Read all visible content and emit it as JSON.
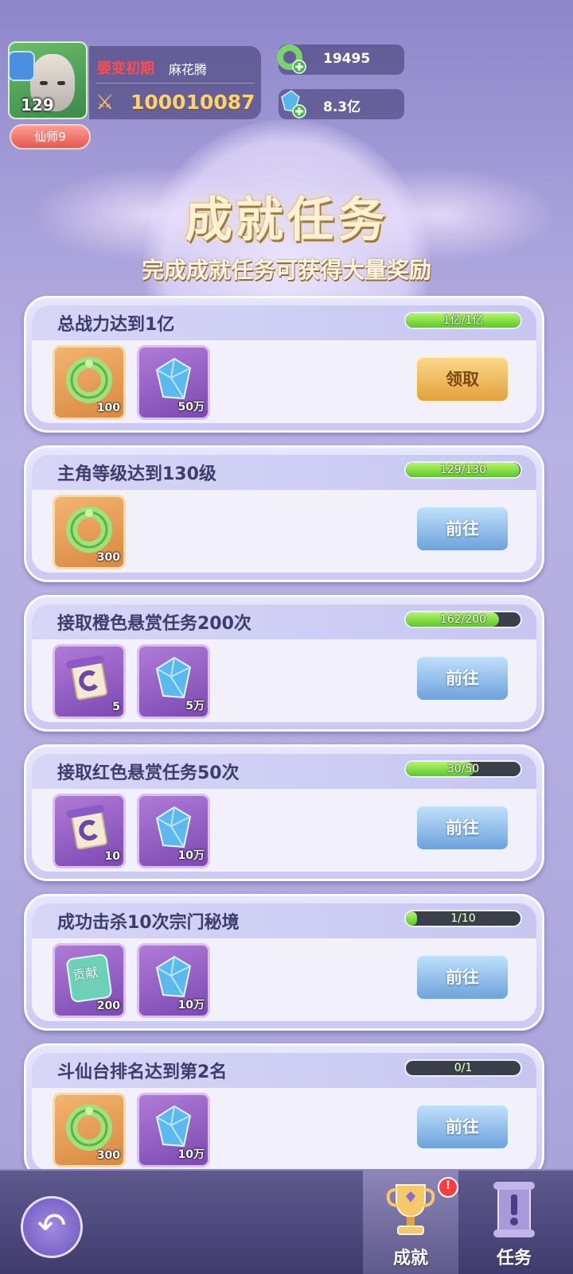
{
  "player": {
    "level": "129",
    "title": "仙师9",
    "realm": "婴变初期",
    "name": "麻花腾",
    "power": "100010087"
  },
  "resources": [
    {
      "icon": "jade-ring-icon",
      "value": "19495"
    },
    {
      "icon": "crystal-icon",
      "value": "8.3亿"
    }
  ],
  "header": {
    "title": "成就任务",
    "subtitle": "完成成就任务可获得大量奖励"
  },
  "tasks": [
    {
      "title": "总战力达到1亿",
      "progress_text": "1亿/1亿",
      "progress": 1.0,
      "rewards": [
        {
          "icon": "jade-ring-icon",
          "count": "100"
        },
        {
          "icon": "crystal-icon",
          "count": "50万"
        }
      ],
      "button": "领取",
      "button_type": "claim"
    },
    {
      "title": "主角等级达到130级",
      "progress_text": "129/130",
      "progress": 0.992,
      "rewards": [
        {
          "icon": "jade-ring-icon",
          "count": "300"
        }
      ],
      "button": "前往",
      "button_type": "go"
    },
    {
      "title": "接取橙色悬赏任务200次",
      "progress_text": "162/200",
      "progress": 0.81,
      "rewards": [
        {
          "icon": "scroll-icon",
          "count": "5"
        },
        {
          "icon": "crystal-icon",
          "count": "5万"
        }
      ],
      "button": "前往",
      "button_type": "go"
    },
    {
      "title": "接取红色悬赏任务50次",
      "progress_text": "30/50",
      "progress": 0.6,
      "rewards": [
        {
          "icon": "scroll-icon",
          "count": "10"
        },
        {
          "icon": "crystal-icon",
          "count": "10万"
        }
      ],
      "button": "前往",
      "button_type": "go"
    },
    {
      "title": "成功击杀10次宗门秘境",
      "progress_text": "1/10",
      "progress": 0.1,
      "rewards": [
        {
          "icon": "contribution-token-icon",
          "count": "200",
          "label": "贡献"
        },
        {
          "icon": "crystal-icon",
          "count": "10万"
        }
      ],
      "button": "前往",
      "button_type": "go"
    },
    {
      "title": "斗仙台排名达到第2名",
      "progress_text": "0/1",
      "progress": 0.0,
      "rewards": [
        {
          "icon": "jade-ring-icon",
          "count": "300"
        },
        {
          "icon": "crystal-icon",
          "count": "10万"
        }
      ],
      "button": "前往",
      "button_type": "go"
    }
  ],
  "bottom_nav": {
    "back": "back-arrow-icon",
    "tabs": [
      {
        "label": "成就",
        "icon": "trophy-icon",
        "badge": "!",
        "active": true
      },
      {
        "label": "任务",
        "icon": "quest-scroll-icon",
        "active": false
      }
    ]
  },
  "colors": {
    "claim": "#e2a23c",
    "go": "#6ea2dc",
    "progress": "#5cc72a"
  }
}
